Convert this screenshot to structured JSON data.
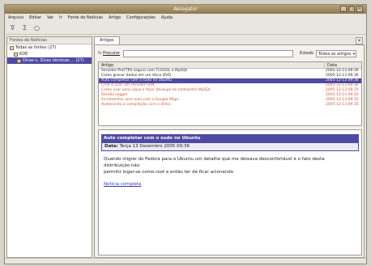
{
  "window": {
    "title": "Akregator"
  },
  "menu": [
    "Arquivo",
    "Editar",
    "Ver",
    "Ir",
    "Fonte de Notícias",
    "Artigo",
    "Configurações",
    "Ajuda"
  ],
  "toolbar": {
    "icons": [
      "filter-icon",
      "sigma-icon",
      "refresh-icon"
    ]
  },
  "sidebar": {
    "header": "Fontes de Notícias",
    "items": [
      {
        "label": "Todas as fontes (27)",
        "level": 0,
        "selected": false
      },
      {
        "label": "KDE",
        "level": 1,
        "selected": false
      },
      {
        "label": "Dicas-L: Dicas técnicas ... (27)",
        "level": 2,
        "selected": true
      }
    ]
  },
  "tab": {
    "label": "Artigos"
  },
  "search": {
    "label": "Procurar",
    "state_label": "Estado",
    "state_value": "Todos os artigos"
  },
  "list": {
    "headers": [
      "Artigo",
      "Data"
    ],
    "rows": [
      {
        "title": "Servidor ProFTPd seguro com TLS/SSL e MySQL",
        "date": "2005-12-13 09:36",
        "status": "read"
      },
      {
        "title": "Como gravar dados em um disco DVD",
        "date": "2005-12-13 09:36",
        "status": "read"
      },
      {
        "title": "Auto completar com o sudo no Ubuntu",
        "date": "2005-12-13 09:36",
        "status": "selected"
      },
      {
        "title": "Criar e usar um servidor SVN",
        "date": "2005-12-13 09:36",
        "status": "unread"
      },
      {
        "title": "Como usar uma cópia e fazer backups de ambientes MySQL",
        "date": "2005-12-13 09:35",
        "status": "unread"
      },
      {
        "title": "Sessão Logger",
        "date": "2005-12-13 09:35",
        "status": "unread"
      },
      {
        "title": "Incrementar uma aula com o Google Maps",
        "date": "2005-12-13 09:35",
        "status": "unread"
      },
      {
        "title": "Acelerando a compilação com o distcc",
        "date": "2005-12-13 09:35",
        "status": "unread"
      }
    ]
  },
  "article": {
    "title": "Auto completar com o sudo no Ubuntu",
    "date_label": "Data:",
    "date_value": "Terça 13 Dezembro 2005 09:36",
    "body_line1": "Quando migrei do Fedora para o Ubuntu um detalhe que me deixava desconfortável é o fato desta",
    "body_line2": "distribuição não",
    "body_line3": "permitir logar-se como root e então ter de ficar acionando",
    "link": "Notícia completa"
  }
}
